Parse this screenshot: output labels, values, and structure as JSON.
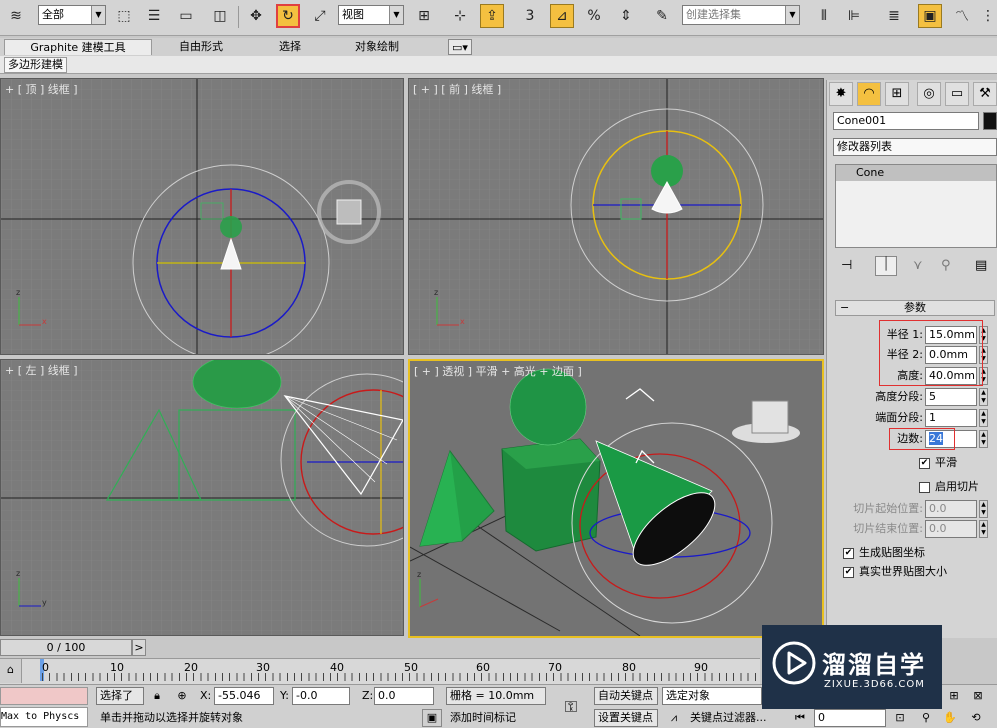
{
  "toolbar": {
    "selection_filter": "全部",
    "reference_coord": "视图",
    "snap_numbers": {
      "snap": "3",
      "angle_snap": "⊿",
      "percent_snap": "%"
    },
    "named_selection_placeholder": "创建选择集",
    "colors": {
      "active": "#f4c040",
      "highlight": "#e04040"
    }
  },
  "ribbon": {
    "tabs": [
      "Graphite 建模工具",
      "自由形式",
      "选择",
      "对象绘制"
    ],
    "active_tab": "Graphite 建模工具",
    "sub_label": "多边形建模"
  },
  "viewports": {
    "top": {
      "label": "+ [ 顶 ] 线框 ]"
    },
    "front": {
      "label": "[ + ] [ 前 ] 线框 ]"
    },
    "left": {
      "label": "+ [ 左 ] 线框 ]"
    },
    "perspective": {
      "label": "[ + ] 透视 ] 平滑 + 高光 + 边面 ]"
    }
  },
  "command_panel": {
    "object_name": "Cone001",
    "modifier_list": "修改器列表",
    "stack": [
      "Cone"
    ],
    "rollout_title": "参数",
    "params": [
      {
        "label": "半径 1:",
        "value": "15.0mm"
      },
      {
        "label": "半径 2:",
        "value": "0.0mm"
      },
      {
        "label": "高度:",
        "value": "40.0mm"
      },
      {
        "label": "高度分段:",
        "value": "5"
      },
      {
        "label": "端面分段:",
        "value": "1"
      },
      {
        "label": "边数:",
        "value": "24"
      }
    ],
    "smooth": {
      "label": "平滑",
      "checked": true
    },
    "slice_on": {
      "label": "启用切片",
      "checked": false
    },
    "slice_from": {
      "label": "切片起始位置:",
      "value": "0.0"
    },
    "slice_to": {
      "label": "切片结束位置:",
      "value": "0.0"
    },
    "gen_map": {
      "label": "生成贴图坐标",
      "checked": true
    },
    "real_world": {
      "label": "真实世界贴图大小",
      "checked": true
    }
  },
  "timeline": {
    "frame_display": "0 / 100",
    "next": ">",
    "ticks": [
      "0",
      "10",
      "20",
      "30",
      "40",
      "50",
      "60",
      "70",
      "80",
      "90"
    ]
  },
  "status": {
    "maxscript": "Max to Physcs (",
    "selected": "选择了",
    "x_label": "X:",
    "x_value": "-55.046",
    "y_label": "Y:",
    "y_value": "-0.0",
    "z_label": "Z:",
    "z_value": "0.0",
    "grid": "栅格 = 10.0mm",
    "prompt": "单击并拖动以选择并旋转对象",
    "add_time_tag": "添加时间标记",
    "auto_key": "自动关键点",
    "set_key": "设置关键点",
    "selection_set": "选定对象",
    "key_filters": "关键点过滤器...",
    "frame_value": "0"
  },
  "watermark": {
    "brand": "溜溜自学",
    "url": "ZIXUE.3D66.COM"
  }
}
